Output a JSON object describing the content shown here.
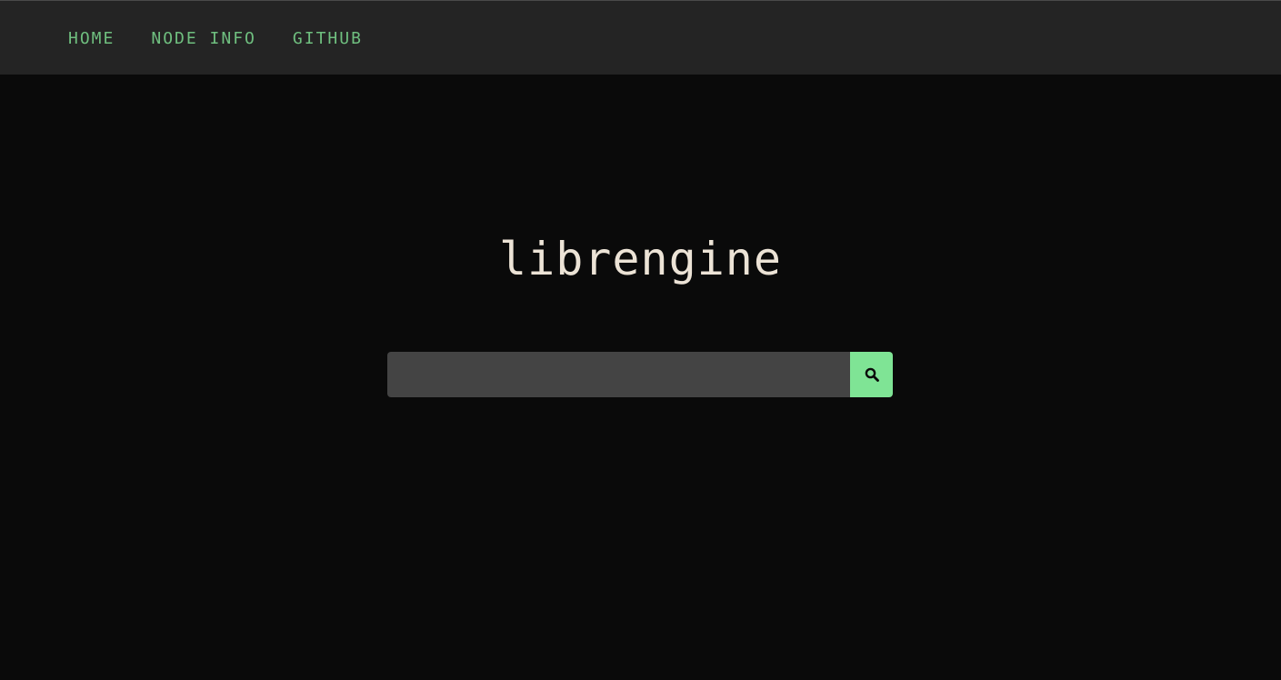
{
  "nav": {
    "items": [
      {
        "label": "HOME"
      },
      {
        "label": "NODE INFO"
      },
      {
        "label": "GITHUB"
      }
    ]
  },
  "logo": {
    "text": "librengine"
  },
  "search": {
    "placeholder": "",
    "value": "",
    "button_icon": "search-icon"
  },
  "colors": {
    "accent": "#7fe495",
    "nav_link": "#6fbf7f",
    "background": "#0a0a0a",
    "topbar": "#242424",
    "input_bg": "#444444",
    "logo_text": "#ece3d6"
  }
}
